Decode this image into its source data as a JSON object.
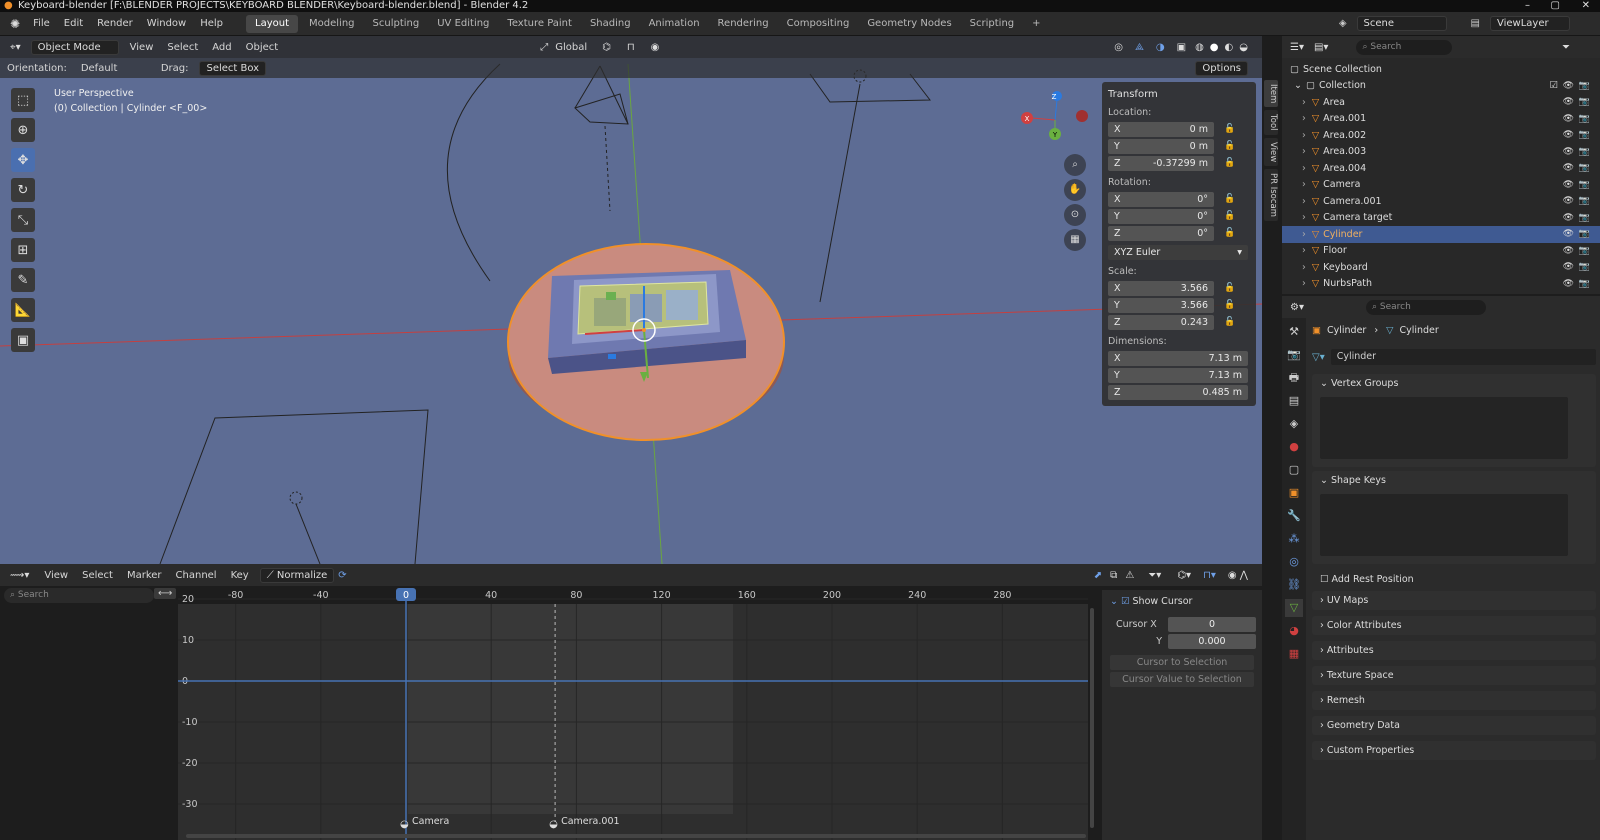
{
  "window": {
    "title": "Keyboard-blender [F:\\BLENDER PROJECTS\\KEYBOARD BLENDER\\Keyboard-blender.blend] - Blender 4.2"
  },
  "menubar": {
    "items": [
      "File",
      "Edit",
      "Render",
      "Window",
      "Help"
    ]
  },
  "workspaces": {
    "tabs": [
      "Layout",
      "Modeling",
      "Sculpting",
      "UV Editing",
      "Texture Paint",
      "Shading",
      "Animation",
      "Rendering",
      "Compositing",
      "Geometry Nodes",
      "Scripting"
    ],
    "active": "Layout",
    "add": "+"
  },
  "scene": {
    "scene_name": "Scene",
    "view_layer": "ViewLayer"
  },
  "viewport": {
    "mode": "Object Mode",
    "menus": [
      "View",
      "Select",
      "Add",
      "Object"
    ],
    "transform_orientation": "Global",
    "orientation_label": "Orientation:",
    "orientation_value": "Default",
    "drag_label": "Drag:",
    "drag_value": "Select Box",
    "options": "Options",
    "overlay_line1": "User Perspective",
    "overlay_line2": "(0) Collection | Cylinder <F_00>",
    "tabs": [
      "Item",
      "Tool",
      "View",
      "PR Isocam"
    ]
  },
  "transform": {
    "title": "Transform",
    "location_label": "Location:",
    "location": [
      {
        "axis": "X",
        "value": "0 m"
      },
      {
        "axis": "Y",
        "value": "0 m"
      },
      {
        "axis": "Z",
        "value": "-0.37299 m"
      }
    ],
    "rotation_label": "Rotation:",
    "rotation": [
      {
        "axis": "X",
        "value": "0°"
      },
      {
        "axis": "Y",
        "value": "0°"
      },
      {
        "axis": "Z",
        "value": "0°"
      }
    ],
    "rotation_mode": "XYZ Euler",
    "scale_label": "Scale:",
    "scale": [
      {
        "axis": "X",
        "value": "3.566"
      },
      {
        "axis": "Y",
        "value": "3.566"
      },
      {
        "axis": "Z",
        "value": "0.243"
      }
    ],
    "dimensions_label": "Dimensions:",
    "dimensions": [
      {
        "axis": "X",
        "value": "7.13 m"
      },
      {
        "axis": "Y",
        "value": "7.13 m"
      },
      {
        "axis": "Z",
        "value": "0.485 m"
      }
    ]
  },
  "outliner": {
    "search_placeholder": "Search",
    "root": "Scene Collection",
    "collection": "Collection",
    "items": [
      {
        "name": "Area",
        "selected": false
      },
      {
        "name": "Area.001",
        "selected": false
      },
      {
        "name": "Area.002",
        "selected": false
      },
      {
        "name": "Area.003",
        "selected": false
      },
      {
        "name": "Area.004",
        "selected": false
      },
      {
        "name": "Camera",
        "selected": false
      },
      {
        "name": "Camera.001",
        "selected": false
      },
      {
        "name": "Camera target",
        "selected": false
      },
      {
        "name": "Cylinder",
        "selected": true
      },
      {
        "name": "Floor",
        "selected": false
      },
      {
        "name": "Keyboard",
        "selected": false
      },
      {
        "name": "NurbsPath",
        "selected": false
      }
    ]
  },
  "properties": {
    "search_placeholder": "Search",
    "breadcrumb_object": "Cylinder",
    "breadcrumb_data": "Cylinder",
    "mesh_name": "Cylinder",
    "vertex_groups": "Vertex Groups",
    "shape_keys": "Shape Keys",
    "add_rest_position": "Add Rest Position",
    "collapsed": [
      "UV Maps",
      "Color Attributes",
      "Attributes",
      "Texture Space",
      "Remesh",
      "Geometry Data",
      "Custom Properties"
    ]
  },
  "graph": {
    "menus": [
      "View",
      "Select",
      "Marker",
      "Channel",
      "Key"
    ],
    "normalize": "Normalize",
    "search_placeholder": "Search",
    "frame_ticks": [
      "-80",
      "-40",
      "0",
      "40",
      "80",
      "120",
      "160",
      "200",
      "240",
      "280"
    ],
    "value_ticks": [
      "20",
      "10",
      "0",
      "-10",
      "-20",
      "-30"
    ],
    "current_frame": "0",
    "markers": [
      "Camera",
      "Camera.001"
    ],
    "show_cursor": "Show Cursor",
    "cursor_x_label": "Cursor X",
    "cursor_x": "0",
    "cursor_y_label": "Y",
    "cursor_y": "0.000",
    "cursor_to_selection": "Cursor to Selection",
    "cursor_value_to_selection": "Cursor Value to Selection"
  },
  "colors": {
    "accent": "#4772b3",
    "selection": "#f0902a",
    "viewport_bg": "#5d6c94"
  }
}
